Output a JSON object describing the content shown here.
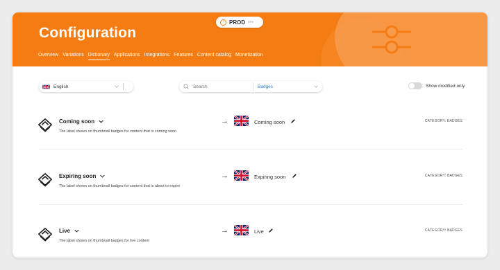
{
  "header": {
    "title": "Configuration",
    "env_label": "PROD",
    "env_sub": "env",
    "nav": [
      "Overview",
      "Variations",
      "Dictionary",
      "Applications",
      "Integrations",
      "Features",
      "Content catalog",
      "Monetization"
    ],
    "active_nav": "Dictionary",
    "accent_color": "#f47c12"
  },
  "toolbar": {
    "language": "English",
    "search_placeholder": "Search",
    "filter": "Badges",
    "toggle_label": "Show modified only",
    "toggle_on": false
  },
  "entries": [
    {
      "title": "Coming soon",
      "description": "The label shown on thumbnail badges for content that is coming soon",
      "value": "Coming soon",
      "category": "CATEGORY: BADGES",
      "icon": "layers-icon"
    },
    {
      "title": "Expiring soon",
      "description": "The label shown on thumbnail badges for content that is about to expire",
      "value": "Expiring soon",
      "category": "CATEGORY: BADGES",
      "icon": "layers-icon"
    },
    {
      "title": "Live",
      "description": "The label shown on thumbnail badges for live content",
      "value": "Live",
      "category": "CATEGORY: BADGES",
      "icon": "layers-icon"
    }
  ]
}
